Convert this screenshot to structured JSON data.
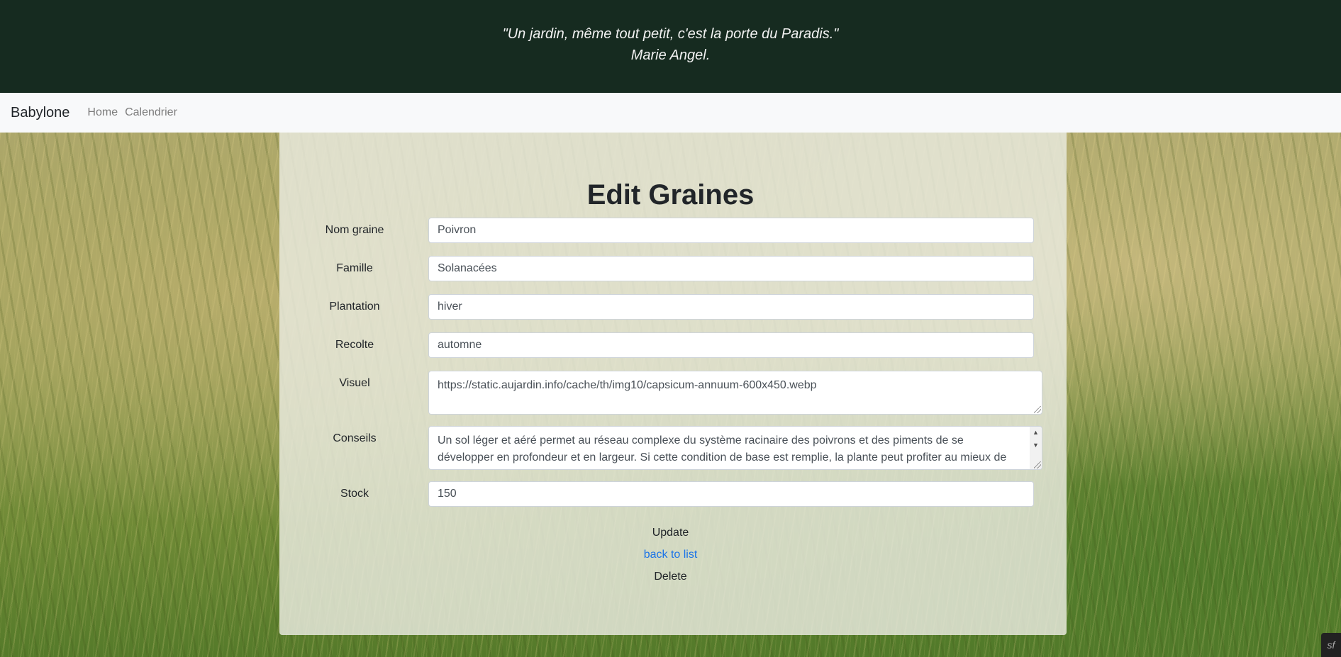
{
  "banner": {
    "quote": "\"Un jardin, même tout petit, c'est la porte du Paradis.\"",
    "author": "Marie Angel."
  },
  "navbar": {
    "brand": "Babylone",
    "links": [
      "Home",
      "Calendrier"
    ]
  },
  "form": {
    "title": "Edit Graines",
    "fields": {
      "nom_graine": {
        "label": "Nom graine",
        "value": "Poivron"
      },
      "famille": {
        "label": "Famille",
        "value": "Solanacées"
      },
      "plantation": {
        "label": "Plantation",
        "value": "hiver"
      },
      "recolte": {
        "label": "Recolte",
        "value": "automne"
      },
      "visuel": {
        "label": "Visuel",
        "value": "https://static.aujardin.info/cache/th/img10/capsicum-annuum-600x450.webp"
      },
      "conseils": {
        "label": "Conseils",
        "value": "Un sol léger et aéré permet au réseau complexe du système racinaire des poivrons et des piments de se développer en profondeur et en largeur. Si cette condition de base est remplie, la plante peut profiter au mieux de l'eau stockée"
      },
      "stock": {
        "label": "Stock",
        "value": "150"
      }
    },
    "update_label": "Update",
    "back_label": "back to list",
    "delete_label": "Delete"
  },
  "icons": {
    "scroll_up": "scroll-up-arrow",
    "scroll_down": "scroll-down-arrow",
    "toolbar": "symfony-logo"
  },
  "colors": {
    "banner_bg": "#162b20",
    "navbar_bg": "#f8f9fa",
    "link": "#1a73e8"
  }
}
